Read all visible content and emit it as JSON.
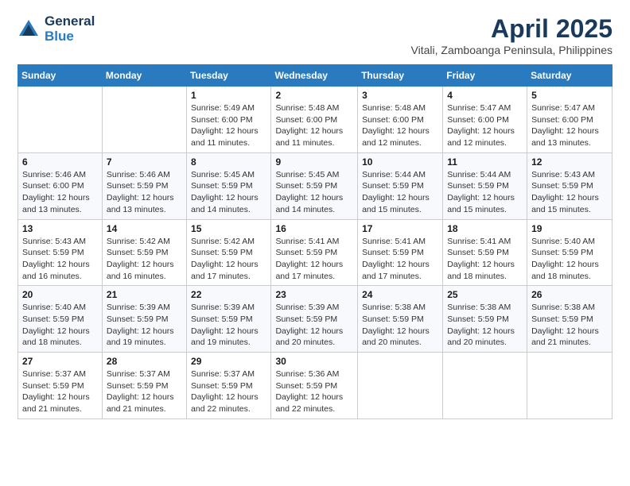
{
  "logo": {
    "general": "General",
    "blue": "Blue"
  },
  "header": {
    "title": "April 2025",
    "subtitle": "Vitali, Zamboanga Peninsula, Philippines"
  },
  "weekdays": [
    "Sunday",
    "Monday",
    "Tuesday",
    "Wednesday",
    "Thursday",
    "Friday",
    "Saturday"
  ],
  "weeks": [
    [
      {
        "day": "",
        "info": ""
      },
      {
        "day": "",
        "info": ""
      },
      {
        "day": "1",
        "info": "Sunrise: 5:49 AM\nSunset: 6:00 PM\nDaylight: 12 hours and 11 minutes."
      },
      {
        "day": "2",
        "info": "Sunrise: 5:48 AM\nSunset: 6:00 PM\nDaylight: 12 hours and 11 minutes."
      },
      {
        "day": "3",
        "info": "Sunrise: 5:48 AM\nSunset: 6:00 PM\nDaylight: 12 hours and 12 minutes."
      },
      {
        "day": "4",
        "info": "Sunrise: 5:47 AM\nSunset: 6:00 PM\nDaylight: 12 hours and 12 minutes."
      },
      {
        "day": "5",
        "info": "Sunrise: 5:47 AM\nSunset: 6:00 PM\nDaylight: 12 hours and 13 minutes."
      }
    ],
    [
      {
        "day": "6",
        "info": "Sunrise: 5:46 AM\nSunset: 6:00 PM\nDaylight: 12 hours and 13 minutes."
      },
      {
        "day": "7",
        "info": "Sunrise: 5:46 AM\nSunset: 5:59 PM\nDaylight: 12 hours and 13 minutes."
      },
      {
        "day": "8",
        "info": "Sunrise: 5:45 AM\nSunset: 5:59 PM\nDaylight: 12 hours and 14 minutes."
      },
      {
        "day": "9",
        "info": "Sunrise: 5:45 AM\nSunset: 5:59 PM\nDaylight: 12 hours and 14 minutes."
      },
      {
        "day": "10",
        "info": "Sunrise: 5:44 AM\nSunset: 5:59 PM\nDaylight: 12 hours and 15 minutes."
      },
      {
        "day": "11",
        "info": "Sunrise: 5:44 AM\nSunset: 5:59 PM\nDaylight: 12 hours and 15 minutes."
      },
      {
        "day": "12",
        "info": "Sunrise: 5:43 AM\nSunset: 5:59 PM\nDaylight: 12 hours and 15 minutes."
      }
    ],
    [
      {
        "day": "13",
        "info": "Sunrise: 5:43 AM\nSunset: 5:59 PM\nDaylight: 12 hours and 16 minutes."
      },
      {
        "day": "14",
        "info": "Sunrise: 5:42 AM\nSunset: 5:59 PM\nDaylight: 12 hours and 16 minutes."
      },
      {
        "day": "15",
        "info": "Sunrise: 5:42 AM\nSunset: 5:59 PM\nDaylight: 12 hours and 17 minutes."
      },
      {
        "day": "16",
        "info": "Sunrise: 5:41 AM\nSunset: 5:59 PM\nDaylight: 12 hours and 17 minutes."
      },
      {
        "day": "17",
        "info": "Sunrise: 5:41 AM\nSunset: 5:59 PM\nDaylight: 12 hours and 17 minutes."
      },
      {
        "day": "18",
        "info": "Sunrise: 5:41 AM\nSunset: 5:59 PM\nDaylight: 12 hours and 18 minutes."
      },
      {
        "day": "19",
        "info": "Sunrise: 5:40 AM\nSunset: 5:59 PM\nDaylight: 12 hours and 18 minutes."
      }
    ],
    [
      {
        "day": "20",
        "info": "Sunrise: 5:40 AM\nSunset: 5:59 PM\nDaylight: 12 hours and 18 minutes."
      },
      {
        "day": "21",
        "info": "Sunrise: 5:39 AM\nSunset: 5:59 PM\nDaylight: 12 hours and 19 minutes."
      },
      {
        "day": "22",
        "info": "Sunrise: 5:39 AM\nSunset: 5:59 PM\nDaylight: 12 hours and 19 minutes."
      },
      {
        "day": "23",
        "info": "Sunrise: 5:39 AM\nSunset: 5:59 PM\nDaylight: 12 hours and 20 minutes."
      },
      {
        "day": "24",
        "info": "Sunrise: 5:38 AM\nSunset: 5:59 PM\nDaylight: 12 hours and 20 minutes."
      },
      {
        "day": "25",
        "info": "Sunrise: 5:38 AM\nSunset: 5:59 PM\nDaylight: 12 hours and 20 minutes."
      },
      {
        "day": "26",
        "info": "Sunrise: 5:38 AM\nSunset: 5:59 PM\nDaylight: 12 hours and 21 minutes."
      }
    ],
    [
      {
        "day": "27",
        "info": "Sunrise: 5:37 AM\nSunset: 5:59 PM\nDaylight: 12 hours and 21 minutes."
      },
      {
        "day": "28",
        "info": "Sunrise: 5:37 AM\nSunset: 5:59 PM\nDaylight: 12 hours and 21 minutes."
      },
      {
        "day": "29",
        "info": "Sunrise: 5:37 AM\nSunset: 5:59 PM\nDaylight: 12 hours and 22 minutes."
      },
      {
        "day": "30",
        "info": "Sunrise: 5:36 AM\nSunset: 5:59 PM\nDaylight: 12 hours and 22 minutes."
      },
      {
        "day": "",
        "info": ""
      },
      {
        "day": "",
        "info": ""
      },
      {
        "day": "",
        "info": ""
      }
    ]
  ]
}
